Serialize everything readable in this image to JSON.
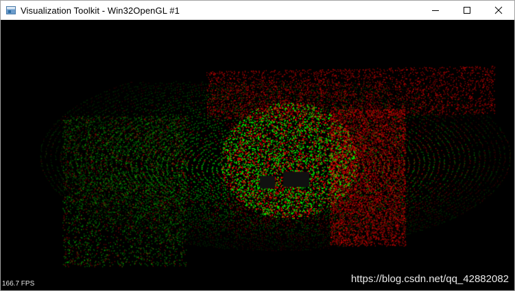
{
  "window": {
    "title": "Visualization Toolkit - Win32OpenGL #1"
  },
  "titlebar_controls": {
    "minimize_icon": "minimize-icon",
    "maximize_icon": "maximize-icon",
    "close_icon": "close-icon"
  },
  "viewport": {
    "fps_text": "166.7 FPS",
    "background_color": "#000000",
    "point_cloud_colors": {
      "source": "#ff0000",
      "target": "#00ff00"
    }
  },
  "watermark": {
    "text": "https://blog.csdn.net/qq_42882082"
  }
}
